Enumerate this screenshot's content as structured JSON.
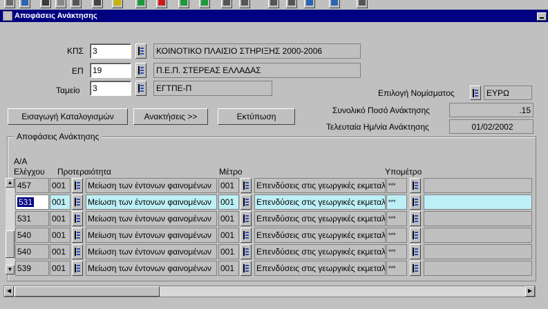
{
  "window": {
    "title": "Αποφάσεις Ανάκτησης"
  },
  "toolbar": {
    "icons": [
      "save-icon",
      "back-icon",
      "edit-icon",
      "clear-icon",
      "print-icon",
      "cut-icon",
      "pen-icon",
      "add-icon",
      "delete-icon",
      "up-icon",
      "forward-icon",
      "list-icon",
      "form-icon",
      "copy-icon",
      "table-icon",
      "info-icon",
      "exit-icon"
    ]
  },
  "header": {
    "kps_label": "ΚΠΣ",
    "kps_code": "3",
    "kps_desc": "ΚΟΙΝΟΤΙΚΟ ΠΛΑΙΣΙΟ ΣΤΗΡΙΞΗΣ 2000-2006",
    "ep_label": "ΕΠ",
    "ep_code": "19",
    "ep_desc": "Π.Ε.Π. ΣΤΕΡΕΑΣ ΕΛΛΑΔΑΣ",
    "tameio_label": "Ταμείο",
    "tameio_code": "3",
    "tameio_desc": "ΕΓΤΠΕ-Π",
    "currency_label": "Επιλογή Νομίσματος",
    "currency_value": "ΕΥΡΩ",
    "total_label": "Συνολικό Ποσό Ανάκτησης",
    "total_value": ".15",
    "last_date_label": "Τελευταία Ημ/νία Ανάκτησης",
    "last_date_value": "01/02/2002"
  },
  "buttons": {
    "import_label": "Εισαγωγή Καταλογισμών",
    "recoveries_label": "Ανακτήσεις >>",
    "print_label": "Εκτύπωση"
  },
  "table": {
    "group_title": "Αποφάσεις Ανάκτησης",
    "col_aa_line1": "Α/Α",
    "col_aa_line2": "Ελέγχου",
    "col_priority": "Προτεραιότητα",
    "col_measure": "Μέτρο",
    "col_submeasure": "Υπομέτρο",
    "rows": [
      {
        "aa": "457",
        "prio_code": "001",
        "prio_desc": "Μείωση των έντονων φαινομένων",
        "measure_code": "001",
        "measure_desc": "Επενδύσεις στις γεωργικές εκμεταλλεύσεις",
        "sub_code": "***"
      },
      {
        "aa": "531",
        "prio_code": "001",
        "prio_desc": "Μείωση των έντονων φαινομένων",
        "measure_code": "001",
        "measure_desc": "Επενδύσεις στις γεωργικές εκμεταλλεύσεις",
        "sub_code": "***"
      },
      {
        "aa": "531",
        "prio_code": "001",
        "prio_desc": "Μείωση των έντονων φαινομένων",
        "measure_code": "001",
        "measure_desc": "Επενδύσεις στις γεωργικές εκμεταλλεύσεις",
        "sub_code": "***"
      },
      {
        "aa": "540",
        "prio_code": "001",
        "prio_desc": "Μείωση των έντονων φαινομένων",
        "measure_code": "001",
        "measure_desc": "Επενδύσεις στις γεωργικές εκμεταλλεύσεις",
        "sub_code": "***"
      },
      {
        "aa": "540",
        "prio_code": "001",
        "prio_desc": "Μείωση των έντονων φαινομένων",
        "measure_code": "001",
        "measure_desc": "Επενδύσεις στις γεωργικές εκμεταλλεύσεις",
        "sub_code": "***"
      },
      {
        "aa": "539",
        "prio_code": "001",
        "prio_desc": "Μείωση των έντονων φαινομένων",
        "measure_code": "001",
        "measure_desc": "Επενδύσεις στις γεωργικές εκμεταλλεύσεις",
        "sub_code": "***"
      }
    ]
  },
  "colors": {
    "title_bar": "#000080",
    "selected_row": "#bdf0f6",
    "background": "#c0c0c0"
  }
}
